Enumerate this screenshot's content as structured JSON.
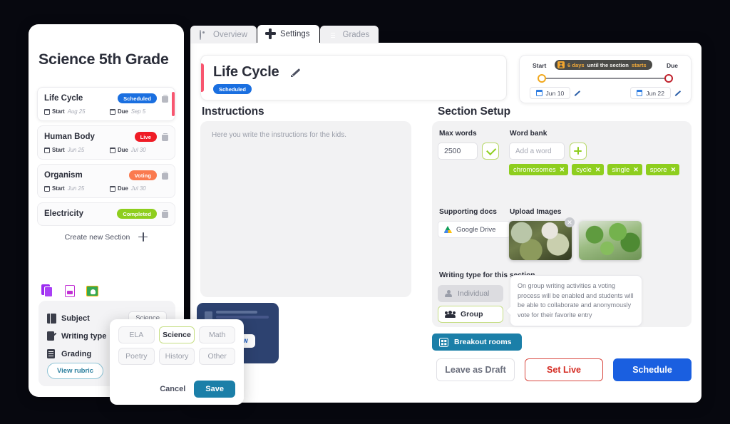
{
  "sidebar": {
    "course_title": "Science 5th Grade",
    "sections": [
      {
        "name": "Life Cycle",
        "status": "Scheduled",
        "status_color": "#1a6fe0",
        "start_label": "Start",
        "start_date": "Aug 25",
        "due_label": "Due",
        "due_date": "Sep 5",
        "active": true
      },
      {
        "name": "Human Body",
        "status": "Live",
        "status_color": "#ef1c26",
        "start_label": "Start",
        "start_date": "Jun 25",
        "due_label": "Due",
        "due_date": "Jul 30",
        "active": false
      },
      {
        "name": "Organism",
        "status": "Voting",
        "status_color": "#fa7a4f",
        "start_label": "Start",
        "start_date": "Jun 25",
        "due_label": "Due",
        "due_date": "Jul 30",
        "active": false
      },
      {
        "name": "Electricity",
        "status": "Completed",
        "status_color": "#8ece1e",
        "start_label": "",
        "start_date": "",
        "due_label": "",
        "due_date": "",
        "active": false
      }
    ],
    "create_new_label": "Create new Section",
    "tool_icons": [
      "duplicate-icon",
      "export-doc-icon",
      "google-classroom-icon"
    ],
    "settings_rows": [
      {
        "label": "Subject",
        "value": "Science"
      },
      {
        "label": "Writing type",
        "value": ""
      },
      {
        "label": "Grading",
        "value": ""
      }
    ],
    "view_rubric_label": "View rubric"
  },
  "tabs": [
    {
      "label": "Overview",
      "icon": "eye-icon",
      "active": false
    },
    {
      "label": "Settings",
      "icon": "gear-icon",
      "active": true
    },
    {
      "label": "Grades",
      "icon": "grades-icon",
      "active": false
    }
  ],
  "title_card": {
    "title": "Life Cycle",
    "badge": "Scheduled",
    "accent_color": "#f8566f"
  },
  "date_range": {
    "start_label": "Start",
    "due_label": "Due",
    "tooltip_prefix": "6 days",
    "tooltip_middle": " until the section ",
    "tooltip_suffix": "starts",
    "start_date": "Jun 10",
    "due_date": "Jun 22",
    "start_knob_color": "#f1a81e",
    "due_knob_color": "#c0212c"
  },
  "instructions": {
    "heading": "Instructions",
    "placeholder": "Here you write the instructions for the kids."
  },
  "preview_card": {
    "button_label": "Preview"
  },
  "section_setup": {
    "heading": "Section Setup",
    "max_words_label": "Max words",
    "max_words_value": "2500",
    "word_bank_label": "Word bank",
    "add_word_placeholder": "Add a word",
    "words": [
      "chromosomes",
      "cycle",
      "single",
      "spore"
    ],
    "supporting_docs_label": "Supporting docs",
    "google_drive_label": "Google Drive",
    "upload_images_label": "Upload Images",
    "writing_type_label": "Writing type for this section",
    "individual_label": "Individual",
    "group_label": "Group",
    "tooltip_text": "On group writing activities a voting process will be enabled and students will be able to collaborate and anonymously vote for their favorite entry",
    "breakout_label": "Breakout rooms"
  },
  "footer": {
    "draft_label": "Leave as Draft",
    "set_live_label": "Set Live",
    "schedule_label": "Schedule"
  },
  "subject_popup": {
    "options": [
      "ELA",
      "Science",
      "Math",
      "Poetry",
      "History",
      "Other"
    ],
    "selected": "Science",
    "cancel_label": "Cancel",
    "save_label": "Save"
  }
}
